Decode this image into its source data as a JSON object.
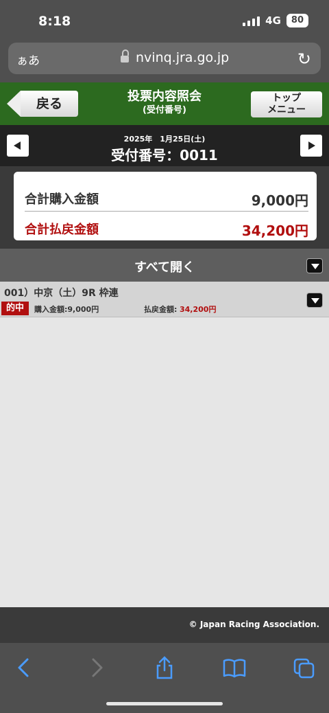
{
  "status": {
    "time": "8:18",
    "network": "4G",
    "battery": "80"
  },
  "browser": {
    "text_size_label": "ぁあ",
    "url": "nvinq.jra.go.jp"
  },
  "header": {
    "back_label": "戻る",
    "title": "投票内容照会",
    "subtitle": "(受付番号)",
    "top_menu_line1": "トップ",
    "top_menu_line2": "メニュー"
  },
  "nav": {
    "date": "2025年　1月25日(土)",
    "receipt_number": "受付番号：0011"
  },
  "totals": {
    "purchase_label": "合計購入金額",
    "purchase_value": "9,000円",
    "payout_label": "合計払戻金額",
    "payout_value": "34,200円"
  },
  "expand_all_label": "すべて開く",
  "bets": [
    {
      "title": "001）中京（土）9R 枠連",
      "badge": "的中",
      "purchase": "購入金額:9,000円",
      "payout_label": "払戻金額:",
      "payout_value": "34,200円"
    }
  ],
  "footer": {
    "copyright": "© Japan Racing Association."
  },
  "icons": {
    "back": "chevron-left-icon",
    "forward": "chevron-right-icon",
    "share": "share-icon",
    "bookmarks": "book-icon",
    "tabs": "tabs-icon",
    "reload": "reload-icon",
    "lock": "lock-icon"
  }
}
